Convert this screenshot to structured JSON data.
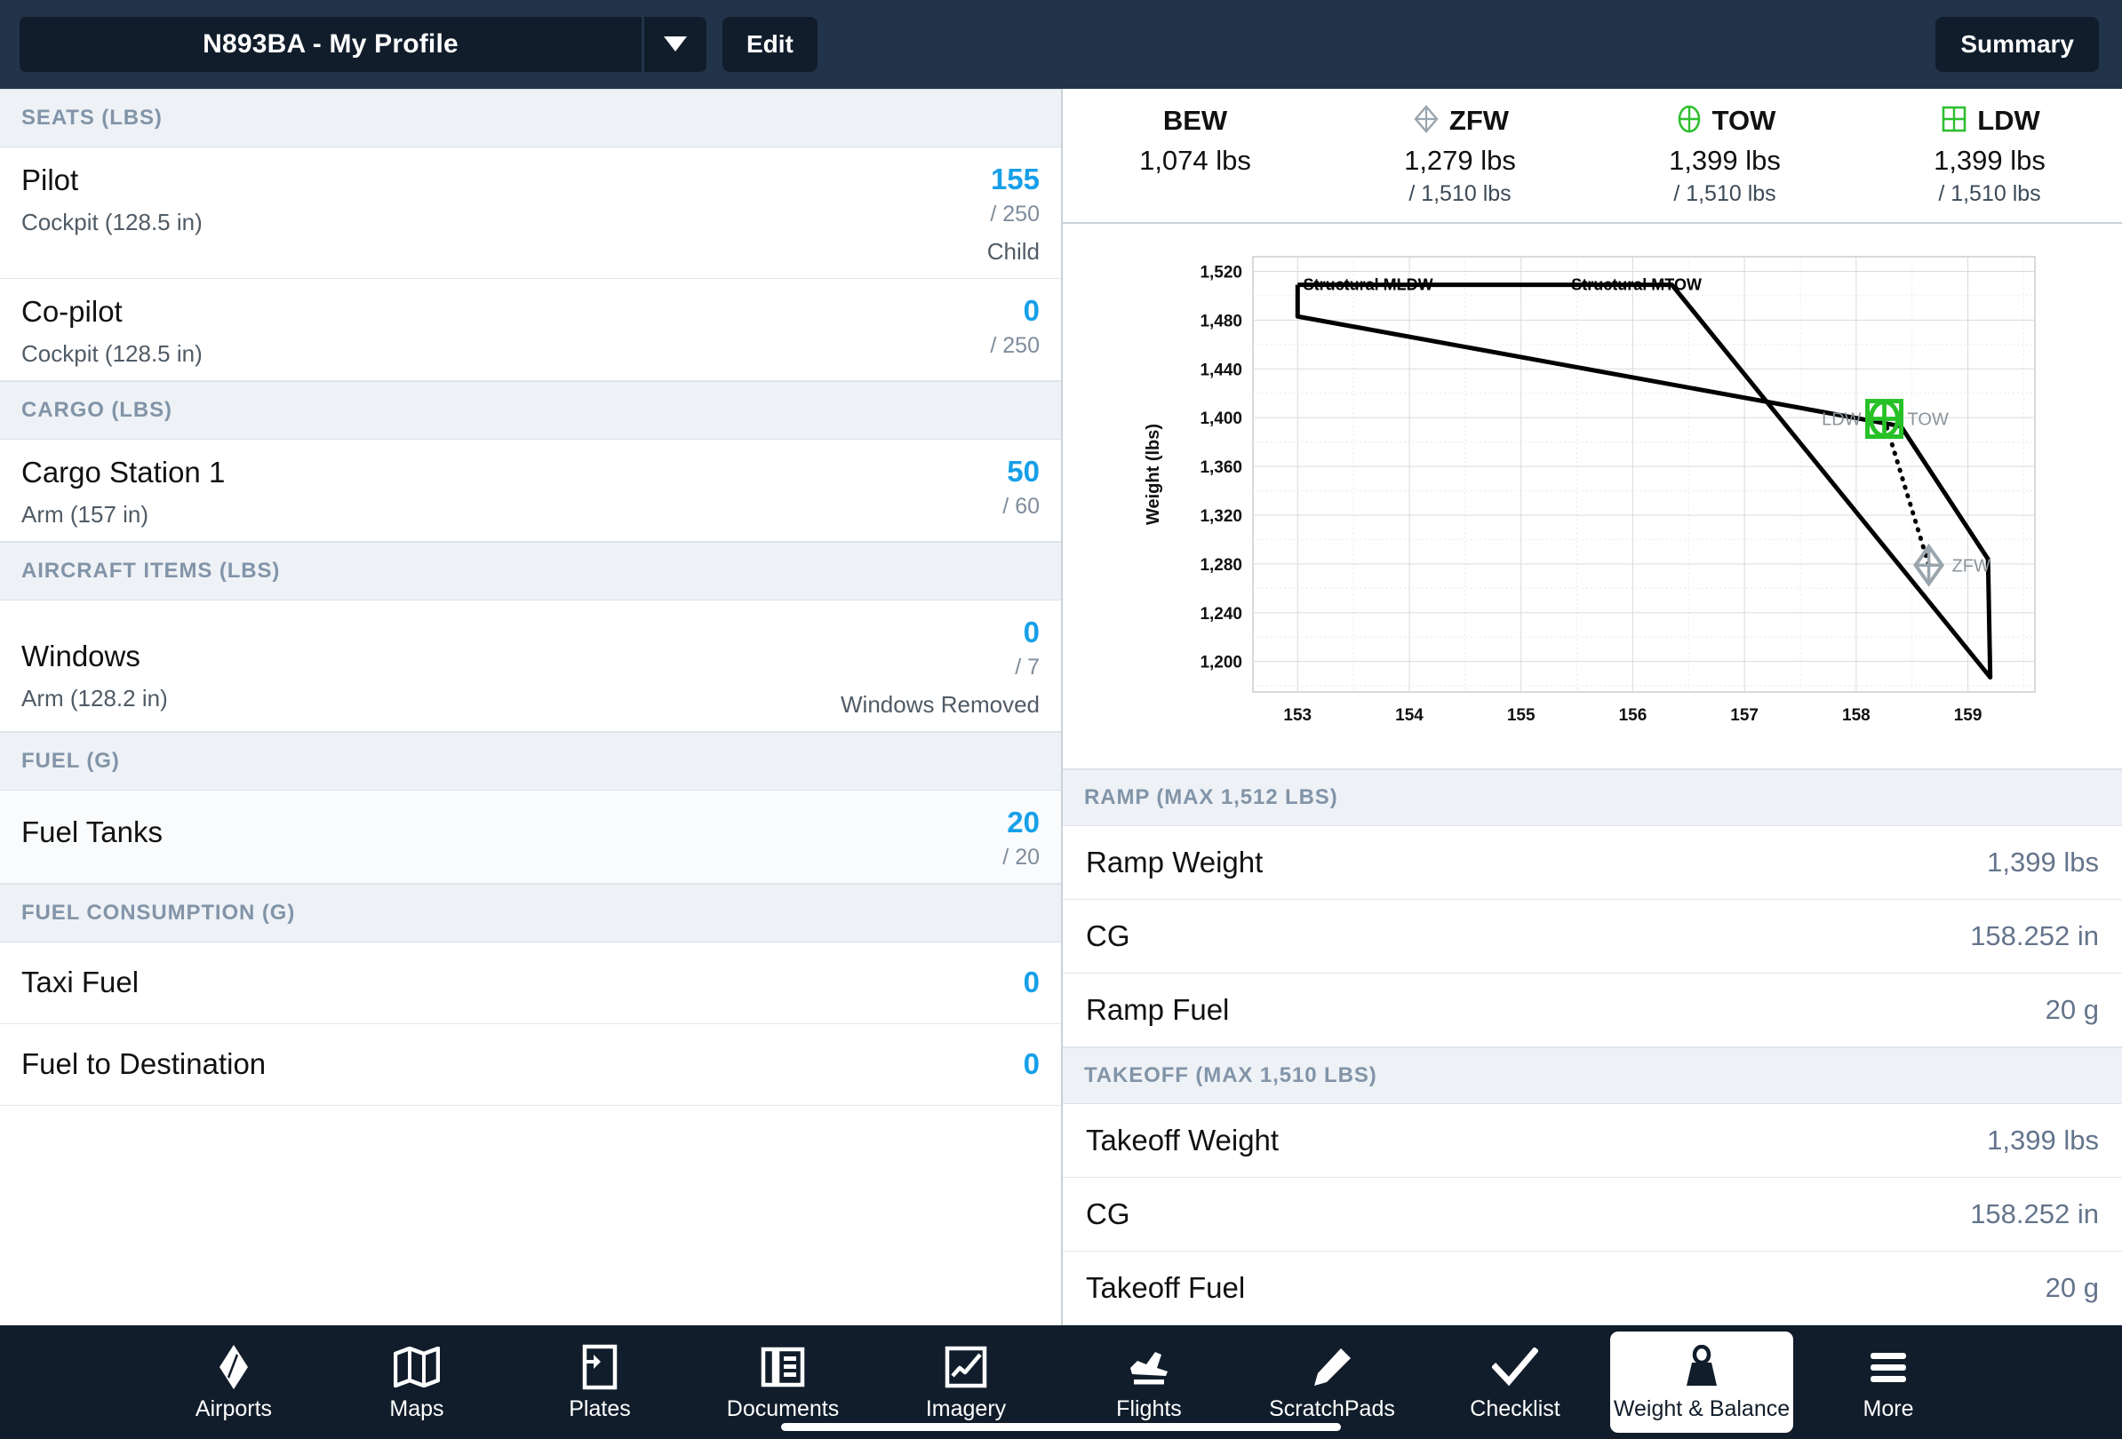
{
  "header": {
    "profile_name": "N893BA - My Profile",
    "dropdown_icon": "chevron-down-icon",
    "edit_label": "Edit",
    "summary_label": "Summary"
  },
  "left_panel": {
    "sections": [
      {
        "title": "SEATS (LBS)",
        "rows": [
          {
            "name": "Pilot",
            "sub": "Cockpit (128.5 in)",
            "value": "155",
            "max": "/ 250",
            "note": "Child"
          },
          {
            "name": "Co-pilot",
            "sub": "Cockpit (128.5 in)",
            "value": "0",
            "max": "/ 250",
            "note": ""
          }
        ]
      },
      {
        "title": "CARGO (LBS)",
        "rows": [
          {
            "name": "Cargo Station 1",
            "sub": "Arm (157 in)",
            "value": "50",
            "max": "/ 60",
            "note": ""
          }
        ]
      },
      {
        "title": "AIRCRAFT ITEMS (LBS)",
        "rows": [
          {
            "name": "Windows",
            "sub": "Arm (128.2 in)",
            "value": "0",
            "max": "/ 7",
            "note": "Windows Removed"
          }
        ]
      },
      {
        "title": "FUEL (G)",
        "rows": [
          {
            "name": "Fuel Tanks",
            "sub": "",
            "value": "20",
            "max": "/ 20",
            "note": ""
          }
        ]
      },
      {
        "title": "FUEL CONSUMPTION (G)",
        "rows": [
          {
            "name": "Taxi Fuel",
            "sub": "",
            "value": "0",
            "max": "",
            "note": ""
          },
          {
            "name": "Fuel to Destination",
            "sub": "",
            "value": "0",
            "max": "",
            "note": ""
          }
        ]
      }
    ]
  },
  "weight_summary": [
    {
      "icon": "none",
      "label": "BEW",
      "value": "1,074 lbs",
      "max": ""
    },
    {
      "icon": "zfw-diamond-icon",
      "label": "ZFW",
      "value": "1,279 lbs",
      "max": "/ 1,510 lbs"
    },
    {
      "icon": "tow-circle-icon",
      "label": "TOW",
      "value": "1,399 lbs",
      "max": "/ 1,510 lbs"
    },
    {
      "icon": "ldw-square-icon",
      "label": "LDW",
      "value": "1,399 lbs",
      "max": "/ 1,510 lbs"
    }
  ],
  "chart_data": {
    "type": "line",
    "title": "",
    "xlabel": "",
    "ylabel": "Weight (lbs)",
    "xlim": [
      152.6,
      159.6
    ],
    "ylim": [
      1175,
      1532
    ],
    "xticks": [
      153,
      154,
      155,
      156,
      157,
      158,
      159
    ],
    "yticks": [
      1200,
      1240,
      1280,
      1320,
      1360,
      1400,
      1440,
      1480,
      1520
    ],
    "ytick_labels": [
      "1,200",
      "1,240",
      "1,280",
      "1,320",
      "1,360",
      "1,400",
      "1,440",
      "1,480",
      "1,520"
    ],
    "grid": true,
    "legend": "none",
    "annotations": [
      {
        "text": "Structural MLDW",
        "x": 153.05,
        "y": 1509
      },
      {
        "text": "Structural MTOW",
        "x": 155.45,
        "y": 1509
      }
    ],
    "series": [
      {
        "name": "Envelope",
        "type": "polygon",
        "points": [
          [
            153.0,
            1509
          ],
          [
            156.35,
            1509
          ],
          [
            159.2,
            1187
          ],
          [
            159.18,
            1284
          ],
          [
            158.4,
            1393
          ],
          [
            153.0,
            1483
          ],
          [
            153.0,
            1509
          ]
        ]
      },
      {
        "name": "CG path",
        "type": "dotted-line",
        "points": [
          [
            158.252,
            1399
          ],
          [
            158.65,
            1279
          ]
        ]
      }
    ],
    "markers": [
      {
        "name": "LDW",
        "label": "LDW",
        "label_side": "left",
        "x": 158.252,
        "y": 1399,
        "shape": "square",
        "color": "#27c127"
      },
      {
        "name": "TOW",
        "label": "TOW",
        "label_side": "right",
        "x": 158.252,
        "y": 1399,
        "shape": "circle-cross",
        "color": "#27c127"
      },
      {
        "name": "ZFW",
        "label": "ZFW",
        "label_side": "right",
        "x": 158.65,
        "y": 1279,
        "shape": "diamond-cross",
        "color": "#9aa5ad"
      }
    ]
  },
  "right_panel": {
    "sections": [
      {
        "title": "RAMP (MAX 1,512 LBS)",
        "rows": [
          {
            "label": "Ramp Weight",
            "value": "1,399 lbs"
          },
          {
            "label": "CG",
            "value": "158.252 in"
          },
          {
            "label": "Ramp Fuel",
            "value": "20 g"
          }
        ]
      },
      {
        "title": "TAKEOFF (MAX 1,510 LBS)",
        "rows": [
          {
            "label": "Takeoff Weight",
            "value": "1,399 lbs"
          },
          {
            "label": "CG",
            "value": "158.252 in"
          },
          {
            "label": "Takeoff Fuel",
            "value": "20 g"
          }
        ]
      }
    ]
  },
  "navbar": {
    "items": [
      {
        "label": "Airports",
        "icon": "airports-compass-icon",
        "active": false
      },
      {
        "label": "Maps",
        "icon": "map-folded-icon",
        "active": false
      },
      {
        "label": "Plates",
        "icon": "plate-document-icon",
        "active": false
      },
      {
        "label": "Documents",
        "icon": "documents-icon",
        "active": false
      },
      {
        "label": "Imagery",
        "icon": "imagery-chart-icon",
        "active": false
      },
      {
        "label": "Flights",
        "icon": "airplane-takeoff-icon",
        "active": false
      },
      {
        "label": "ScratchPads",
        "icon": "pencil-icon",
        "active": false
      },
      {
        "label": "Checklist",
        "icon": "checkmark-icon",
        "active": false
      },
      {
        "label": "Weight & Balance",
        "icon": "weight-icon",
        "active": true
      },
      {
        "label": "More",
        "icon": "hamburger-icon",
        "active": false
      }
    ]
  },
  "colors": {
    "header_bg": "#22344a",
    "button_bg": "#111d2b",
    "accent_blue": "#17a0e8",
    "green": "#27c127",
    "gray_marker": "#9aa5ad",
    "section_header_text": "#8294a8"
  }
}
